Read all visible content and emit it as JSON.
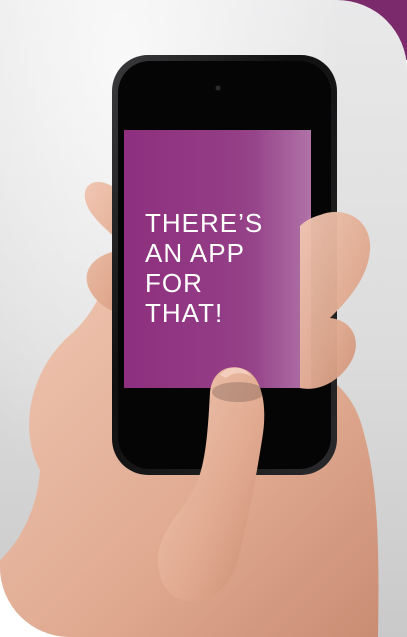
{
  "screen": {
    "message_lines": [
      "THERE’S",
      "AN APP",
      "FOR",
      "THAT!"
    ]
  },
  "colors": {
    "brand_purple": "#7b2b6b",
    "screen_purple": "#8e2f7f",
    "skin": "#e6b39a",
    "background": "#ffffff"
  },
  "icons": {
    "phone": "smartphone",
    "hand": "hand"
  }
}
